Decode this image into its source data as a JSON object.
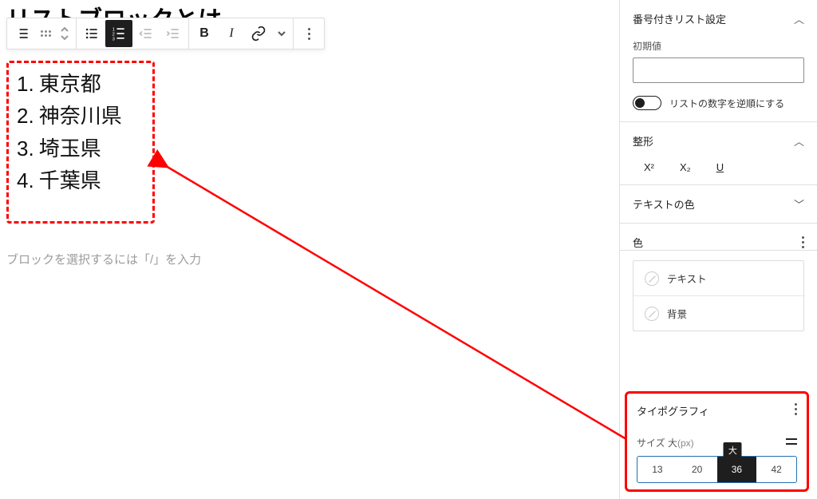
{
  "title": "リストブロックとは",
  "toolbar": {
    "bold": "B",
    "italic": "I"
  },
  "list": {
    "items": [
      {
        "n": "1.",
        "t": "東京都"
      },
      {
        "n": "2.",
        "t": "神奈川県"
      },
      {
        "n": "3.",
        "t": "埼玉県"
      },
      {
        "n": "4.",
        "t": "千葉県"
      }
    ]
  },
  "placeholder": "ブロックを選択するには「/」を入力",
  "sidebar": {
    "ordered": {
      "title": "番号付きリスト設定",
      "initial_label": "初期値",
      "initial_value": "",
      "reverse_label": "リストの数字を逆順にする"
    },
    "format": {
      "title": "整形",
      "sup": "X²",
      "sub": "X₂",
      "u": "U"
    },
    "text_color_title": "テキストの色",
    "color": {
      "title": "色",
      "text_opt": "テキスト",
      "bg_opt": "背景"
    },
    "typo": {
      "title": "タイポグラフィ",
      "size_label": "サイズ ",
      "size_qual": "大",
      "size_unit": "(px)",
      "tooltip": "大",
      "options": [
        "13",
        "20",
        "36",
        "42"
      ],
      "active_index": 2
    }
  }
}
